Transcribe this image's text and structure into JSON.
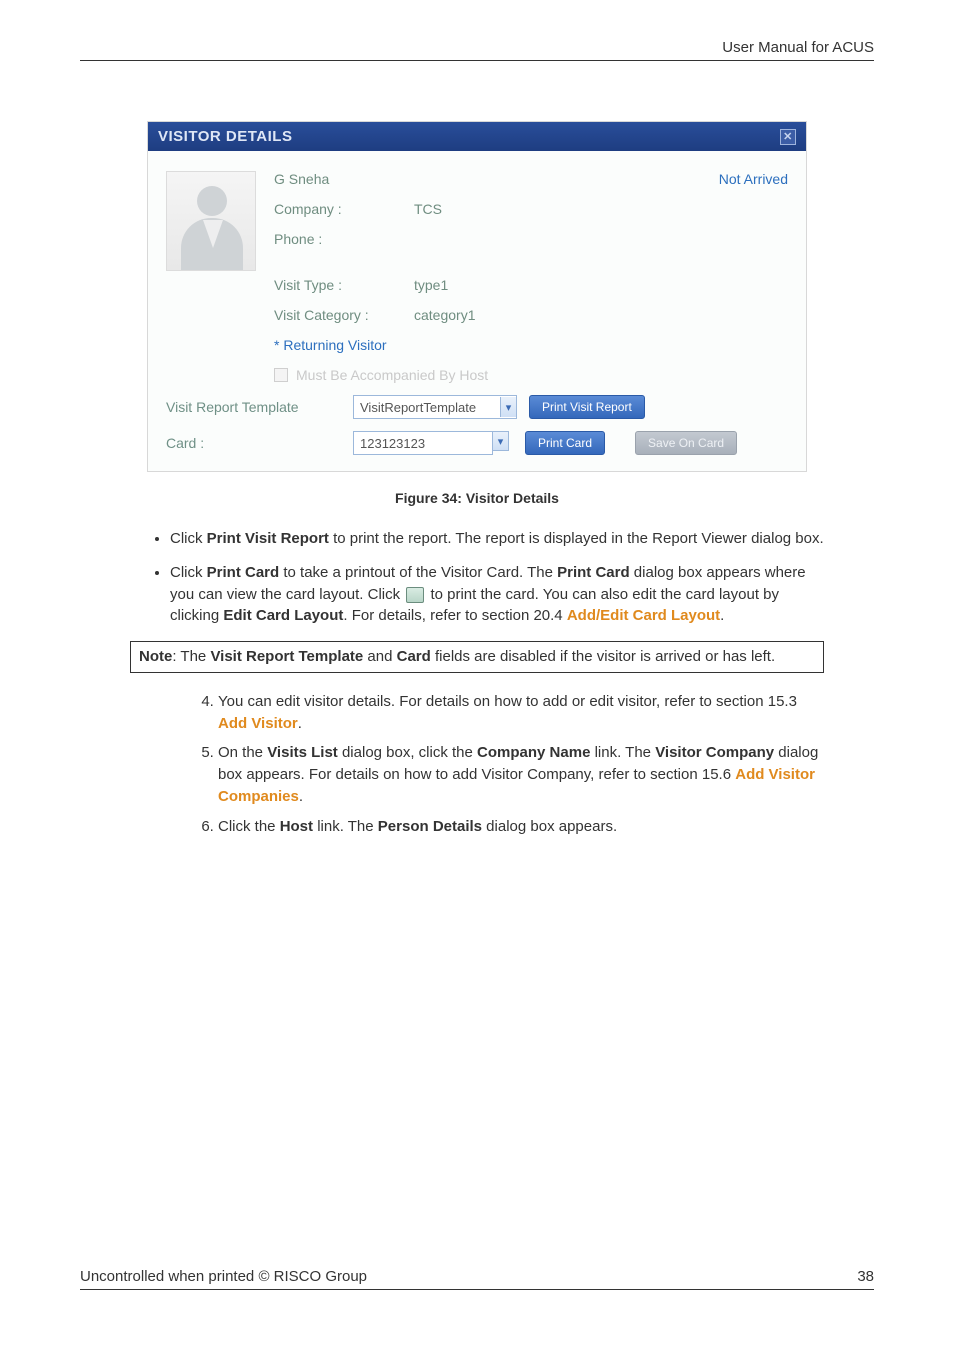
{
  "header": {
    "title": "User Manual for ACUS"
  },
  "screenshot": {
    "title": "VISITOR DETAILS",
    "close_symbol": "✕",
    "visitor_name": "G Sneha",
    "status": "Not Arrived",
    "company_label": "Company :",
    "company_value": "TCS",
    "phone_label": "Phone :",
    "phone_value": "",
    "visit_type_label": "Visit Type :",
    "visit_type_value": "type1",
    "visit_category_label": "Visit Category :",
    "visit_category_value": "category1",
    "returning": "* Returning Visitor",
    "accompanied_label": "Must Be Accompanied By Host",
    "vrt_label": "Visit Report Template",
    "vrt_value": "VisitReportTemplate",
    "print_visit_report": "Print Visit Report",
    "card_label": "Card :",
    "card_value": "123123123",
    "print_card": "Print Card",
    "save_on_card": "Save On Card"
  },
  "figure_caption": "Figure 34: Visitor Details",
  "bullets": {
    "b1_pre": "Click ",
    "b1_bold": "Print Visit Report",
    "b1_post": " to print the report. The report is displayed in the Report Viewer dialog box.",
    "b2_pre": "Click ",
    "b2_bold1": "Print Card",
    "b2_mid1": " to take a printout of the Visitor Card. The ",
    "b2_bold2": "Print Card",
    "b2_mid2": " dialog box appears where you can view the card layout. Click ",
    "b2_post1": " to print the card. You can also edit the card layout by clicking ",
    "b2_bold3": "Edit Card Layout",
    "b2_post2": ". For details, refer to section 20.4 ",
    "b2_link": "Add/Edit Card Layout",
    "b2_end": "."
  },
  "note": {
    "pre": "Note",
    "mid1": ": The ",
    "b1": "Visit Report Template",
    "mid2": " and ",
    "b2": "Card",
    "post": " fields are disabled if the visitor is arrived or has left."
  },
  "steps": {
    "s4_pre": "You can edit visitor details. For details on how to add or edit visitor, refer to section 15.3 ",
    "s4_link": "Add Visitor",
    "s4_end": ".",
    "s5_pre": "On the ",
    "s5_b1": "Visits List",
    "s5_m1": " dialog box, click the ",
    "s5_b2": "Company Name",
    "s5_m2": " link. The ",
    "s5_b3": "Visitor Company",
    "s5_m3": " dialog box appears. For details on how to add Visitor Company, refer to section 15.6 ",
    "s5_link": "Add Visitor Companies",
    "s5_end": ".",
    "s6_pre": "Click the ",
    "s6_b1": "Host",
    "s6_m1": " link. The ",
    "s6_b2": "Person Details",
    "s6_post": " dialog box appears."
  },
  "footer": {
    "left": "Uncontrolled when printed © RISCO Group",
    "right": "38"
  }
}
